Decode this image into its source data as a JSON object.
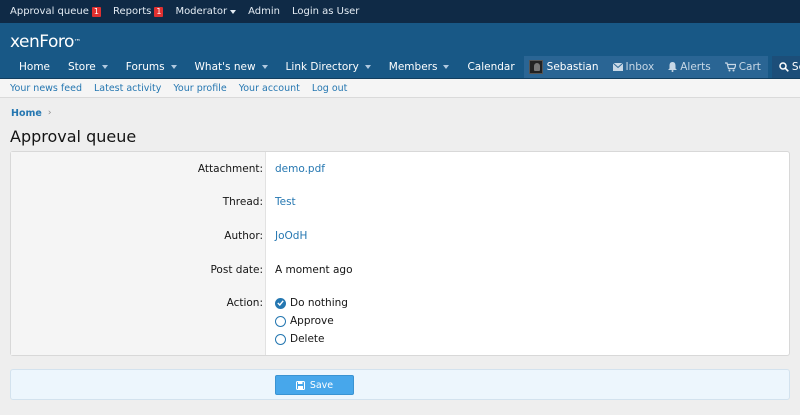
{
  "staffbar": {
    "approval_queue": "Approval queue",
    "approval_count": "1",
    "reports": "Reports",
    "reports_count": "1",
    "moderator": "Moderator",
    "admin": "Admin",
    "login_as_user": "Login as User"
  },
  "header": {
    "logo_main": "xenForo",
    "logo_tm": "™"
  },
  "nav": {
    "items": [
      {
        "label": "Home"
      },
      {
        "label": "Store"
      },
      {
        "label": "Forums"
      },
      {
        "label": "What's new"
      },
      {
        "label": "Link Directory"
      },
      {
        "label": "Members"
      },
      {
        "label": "Calendar"
      }
    ],
    "user": "Sebastian",
    "inbox": "Inbox",
    "alerts": "Alerts",
    "cart": "Cart",
    "search": "Search"
  },
  "subnav": {
    "items": [
      "Your news feed",
      "Latest activity",
      "Your profile",
      "Your account",
      "Log out"
    ]
  },
  "breadcrumb": {
    "home": "Home",
    "chevron": "›"
  },
  "page": {
    "title": "Approval queue"
  },
  "form": {
    "attachment_label": "Attachment:",
    "attachment_value": "demo.pdf",
    "thread_label": "Thread:",
    "thread_value": "Test",
    "author_label": "Author:",
    "author_value": "JoOdH",
    "postdate_label": "Post date:",
    "postdate_value": "A moment ago",
    "action_label": "Action:",
    "actions": [
      {
        "label": "Do nothing",
        "checked": true
      },
      {
        "label": "Approve",
        "checked": false
      },
      {
        "label": "Delete",
        "checked": false
      }
    ],
    "save_label": "Save"
  },
  "colors": {
    "staffbar": "#0f2a46",
    "header": "#185886",
    "link": "#2577b1",
    "button": "#47a7eb",
    "badge": "#e03030"
  },
  "icons": {
    "inbox": "envelope-icon",
    "alerts": "bell-icon",
    "cart": "cart-icon",
    "search": "search-icon",
    "save": "floppy-disk-icon",
    "radio_checked": "check-icon"
  }
}
